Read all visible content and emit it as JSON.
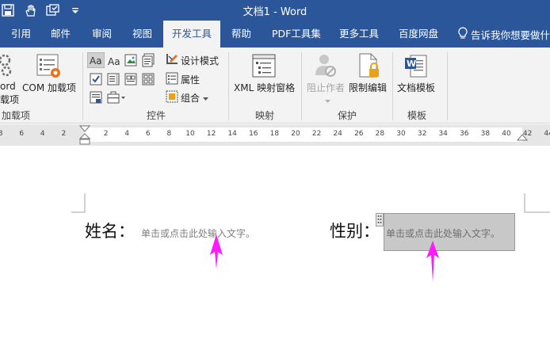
{
  "window": {
    "title": "文档1  -  Word"
  },
  "quick_access": {
    "icons": [
      "save-icon",
      "touch-mode-icon",
      "undo-icon",
      "customize-icon"
    ]
  },
  "tabs": [
    {
      "label": "引用"
    },
    {
      "label": "邮件"
    },
    {
      "label": "审阅"
    },
    {
      "label": "视图"
    },
    {
      "label": "开发工具",
      "active": true
    },
    {
      "label": "帮助"
    },
    {
      "label": "PDF工具集"
    },
    {
      "label": "更多工具"
    },
    {
      "label": "百度网盘"
    }
  ],
  "tell_me": "告诉我你想要做什",
  "ribbon": {
    "addins": {
      "word_label_line1": "ord",
      "word_label_line2": "载项",
      "com_label": "COM 加载项",
      "group": "加载项"
    },
    "controls": {
      "design_mode": "设计模式",
      "properties": "属性",
      "group_btn": "组合",
      "group": "控件"
    },
    "mapping": {
      "xml_pane": "XML 映射窗格",
      "group": "映射"
    },
    "protect": {
      "block_authors": "阻止作者",
      "restrict_editing": "限制编辑",
      "group": "保护"
    },
    "templates": {
      "document_template": "文档模板",
      "group": "模板"
    }
  },
  "ruler": {
    "left_numbers": [
      "8",
      "6",
      "4",
      "2"
    ],
    "right_numbers": [
      "2",
      "4",
      "6",
      "8",
      "10",
      "12",
      "14",
      "16",
      "18",
      "20",
      "22",
      "24",
      "26",
      "28",
      "30",
      "32",
      "34",
      "36",
      "38",
      "40",
      "42",
      "44"
    ]
  },
  "document": {
    "name_label": "姓名：",
    "name_placeholder": "单击或点击此处输入文字。",
    "gender_label": "性别：",
    "gender_placeholder": "单击或点击此处输入文字。"
  },
  "colors": {
    "title_bar": "#2b579a",
    "ribbon": "#f3f3f3",
    "annotation_arrow": "#ff1aff"
  }
}
